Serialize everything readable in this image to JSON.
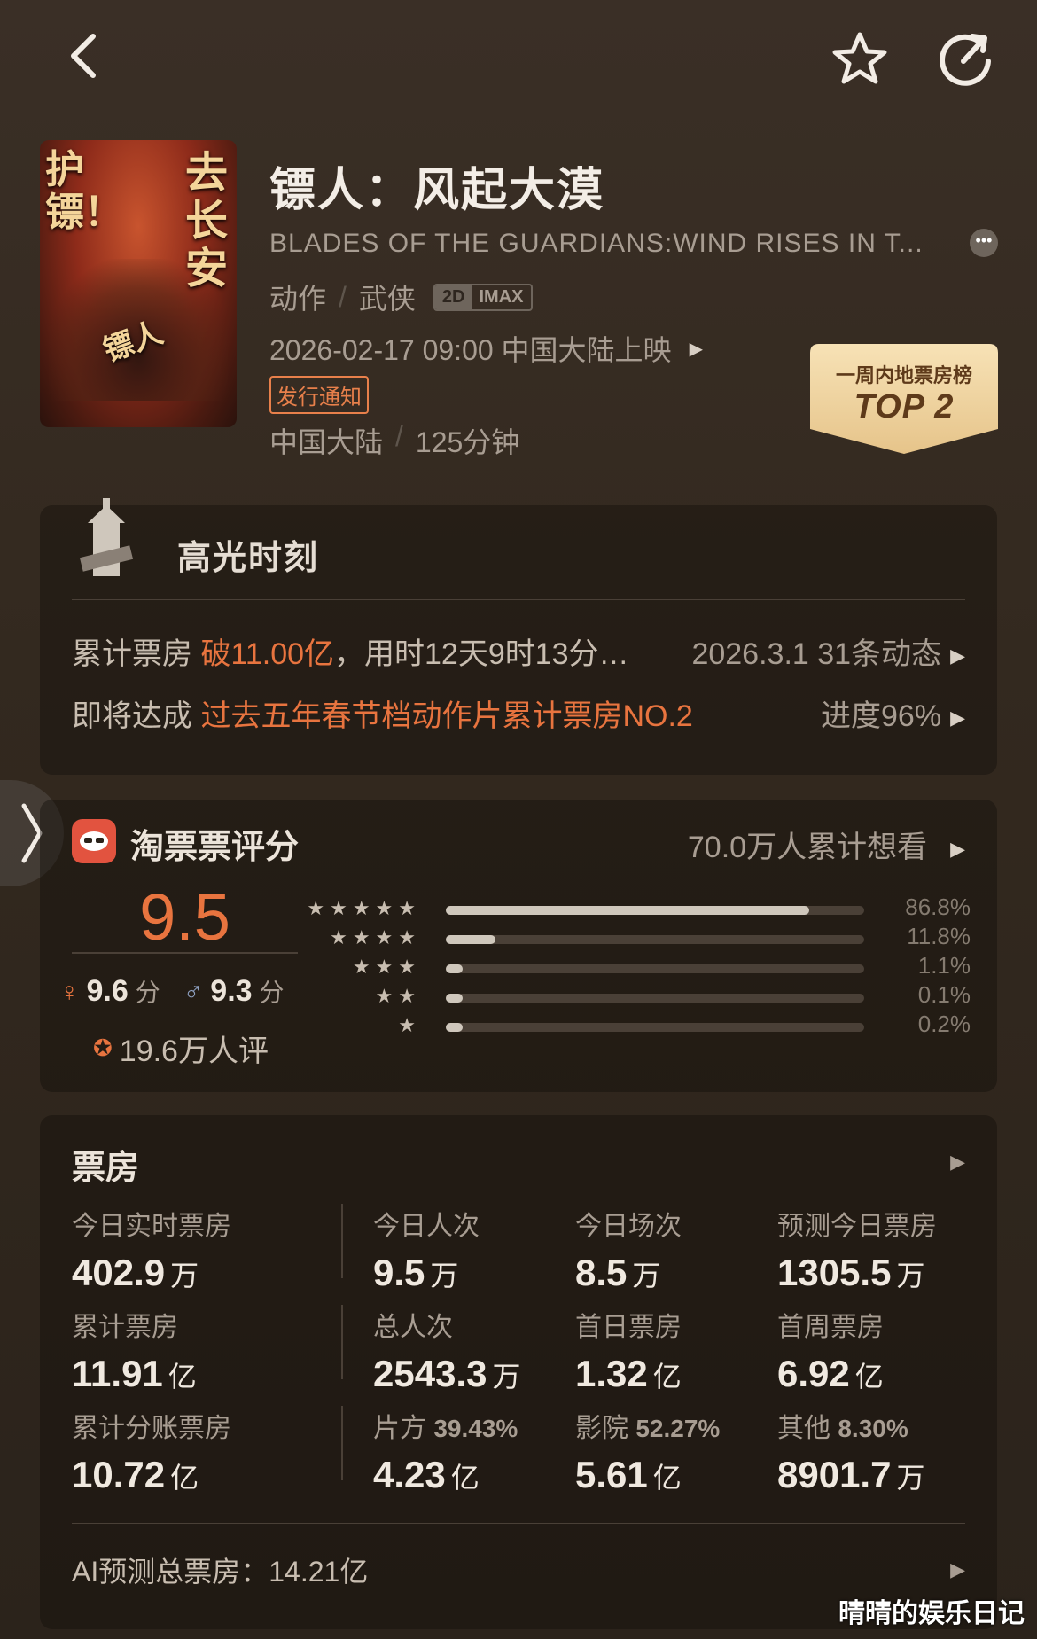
{
  "movie": {
    "title": "镖人：风起大漠",
    "english_title": "BLADES OF THE GUARDIANS:WIND RISES IN T...",
    "genres": [
      "动作",
      "武侠"
    ],
    "formats": [
      "2D",
      "IMAX"
    ],
    "release": "2026-02-17 09:00 中国大陆上映",
    "notice_tag": "发行通知",
    "region": "中国大陆",
    "runtime": "125分钟",
    "poster_text": {
      "left": "护镖！",
      "right": "去长安",
      "logo": "镖人"
    }
  },
  "rank_badge": {
    "label": "一周内地票房榜",
    "value": "TOP 2"
  },
  "highlights": {
    "title": "高光时刻",
    "rows": [
      {
        "prefix": "累计票房 ",
        "highlight": "破11.00亿",
        "suffix": "，用时12天9时13分…",
        "meta": "2026.3.1 31条动态"
      },
      {
        "prefix": "即将达成 ",
        "highlight": "过去五年春节档动作片累计票房NO.2",
        "suffix": "",
        "meta": "进度96%"
      }
    ]
  },
  "rating": {
    "source": "淘票票评分",
    "want_to_watch": "70.0万人累计想看",
    "score": "9.5",
    "female_score": "9.6",
    "male_score": "9.3",
    "score_unit": "分",
    "raters": "19.6万人评",
    "distribution": [
      {
        "stars": "★★★★★",
        "percent": 86.8,
        "label": "86.8%"
      },
      {
        "stars": "★★★★",
        "percent": 11.8,
        "label": "11.8%"
      },
      {
        "stars": "★★★",
        "percent": 1.1,
        "label": "1.1%"
      },
      {
        "stars": "★★",
        "percent": 0.1,
        "label": "0.1%"
      },
      {
        "stars": "★",
        "percent": 0.2,
        "label": "0.2%"
      }
    ]
  },
  "box_office": {
    "title": "票房",
    "stats": [
      {
        "label": "今日实时票房",
        "value": "402.9",
        "unit": "万"
      },
      {
        "label": "今日人次",
        "value": "9.5",
        "unit": "万"
      },
      {
        "label": "今日场次",
        "value": "8.5",
        "unit": "万"
      },
      {
        "label": "预测今日票房",
        "value": "1305.5",
        "unit": "万"
      },
      {
        "label": "累计票房",
        "value": "11.91",
        "unit": "亿"
      },
      {
        "label": "总人次",
        "value": "2543.3",
        "unit": "万"
      },
      {
        "label": "首日票房",
        "value": "1.32",
        "unit": "亿"
      },
      {
        "label": "首周票房",
        "value": "6.92",
        "unit": "亿"
      },
      {
        "label": "累计分账票房",
        "value": "10.72",
        "unit": "亿"
      },
      {
        "label": "片方",
        "label_pct": "39.43%",
        "value": "4.23",
        "unit": "亿"
      },
      {
        "label": "影院",
        "label_pct": "52.27%",
        "value": "5.61",
        "unit": "亿"
      },
      {
        "label": "其他",
        "label_pct": "8.30%",
        "value": "8901.7",
        "unit": "万"
      }
    ],
    "ai_prediction": "AI预测总票房：14.21亿"
  },
  "watermark": "晴晴的娱乐日记",
  "colors": {
    "accent": "#e8743f",
    "background": "#33291f",
    "badge_gold": "#f2d7a4"
  }
}
